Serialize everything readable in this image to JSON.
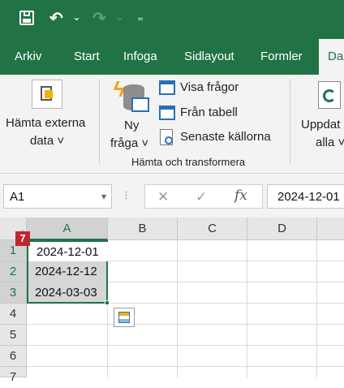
{
  "quick_access": {
    "save_icon": "save-icon",
    "undo_icon": "undo-icon",
    "redo_icon": "redo-icon",
    "customize_icon": "customize-icon",
    "dropdown_glyph": "⌄",
    "customize_glyph": "₌"
  },
  "tabs": [
    {
      "label": "Arkiv"
    },
    {
      "label": "Start"
    },
    {
      "label": "Infoga"
    },
    {
      "label": "Sidlayout"
    },
    {
      "label": "Formler"
    },
    {
      "label": "Da"
    }
  ],
  "ribbon": {
    "get_external_data": {
      "line1": "Hämta externa",
      "line2": "data ˅"
    },
    "new_query": {
      "line1": "Ny",
      "line2": "fråga ˅"
    },
    "show_queries": "Visa frågor",
    "from_table": "Från tabell",
    "recent_sources": "Senaste källorna",
    "group_label": "Hämta och transformera",
    "refresh_all": {
      "line1": "Uppdat",
      "line2": "alla ˅"
    }
  },
  "formula_bar": {
    "name_box": "A1",
    "name_box_arrow": "▾",
    "separator": "⁝",
    "cancel_glyph": "✕",
    "enter_glyph": "✓",
    "fx_label": "fx",
    "formula": "2024-12-01"
  },
  "sheet": {
    "columns": [
      "A",
      "B",
      "C",
      "D"
    ],
    "rows": [
      "1",
      "2",
      "3",
      "4",
      "5",
      "6",
      "7"
    ],
    "cells": [
      "2024-12-01",
      "2024-12-12",
      "2024-03-03"
    ],
    "step_badge": "7"
  },
  "colors": {
    "brand": "#217346",
    "badge": "#c0272d",
    "selection": "#d6d6d6"
  }
}
